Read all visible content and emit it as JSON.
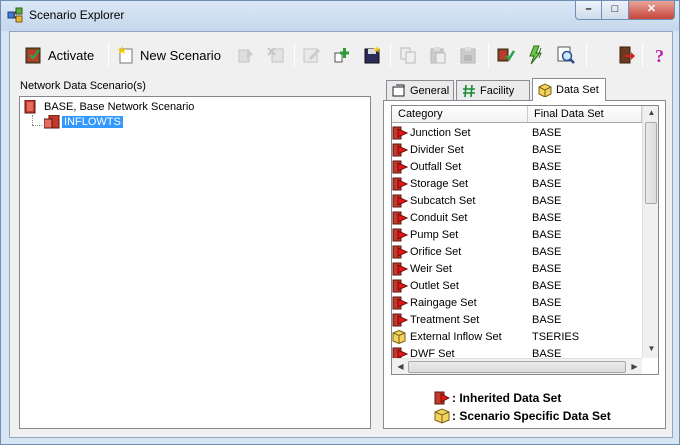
{
  "window": {
    "title": "Scenario Explorer"
  },
  "toolbar": {
    "activate_label": "Activate",
    "new_scenario_label": "New Scenario"
  },
  "left_pane": {
    "header": "Network Data Scenario(s)",
    "tree": [
      {
        "label": "BASE, Base Network Scenario",
        "level": 0,
        "selected": false
      },
      {
        "label": "INFLOWTS",
        "level": 1,
        "selected": true
      }
    ]
  },
  "tabs": [
    {
      "label": "General",
      "icon": "general-icon",
      "active": false
    },
    {
      "label": "Facility",
      "icon": "hash-icon",
      "active": false
    },
    {
      "label": "Data Set",
      "icon": "box-icon",
      "active": true
    }
  ],
  "data_set_grid": {
    "columns": [
      "Category",
      "Final Data Set"
    ],
    "rows": [
      {
        "category": "Junction Set",
        "value": "BASE",
        "type": "inherited"
      },
      {
        "category": "Divider Set",
        "value": "BASE",
        "type": "inherited"
      },
      {
        "category": "Outfall Set",
        "value": "BASE",
        "type": "inherited"
      },
      {
        "category": "Storage Set",
        "value": "BASE",
        "type": "inherited"
      },
      {
        "category": "Subcatch Set",
        "value": "BASE",
        "type": "inherited"
      },
      {
        "category": "Conduit Set",
        "value": "BASE",
        "type": "inherited"
      },
      {
        "category": "Pump Set",
        "value": "BASE",
        "type": "inherited"
      },
      {
        "category": "Orifice Set",
        "value": "BASE",
        "type": "inherited"
      },
      {
        "category": "Weir Set",
        "value": "BASE",
        "type": "inherited"
      },
      {
        "category": "Outlet Set",
        "value": "BASE",
        "type": "inherited"
      },
      {
        "category": "Raingage Set",
        "value": "BASE",
        "type": "inherited"
      },
      {
        "category": "Treatment Set",
        "value": "BASE",
        "type": "inherited"
      },
      {
        "category": "External Inflow Set",
        "value": "TSERIES",
        "type": "specific"
      },
      {
        "category": "DWF Set",
        "value": "BASE",
        "type": "inherited"
      }
    ]
  },
  "legend": {
    "inherited": ": Inherited Data Set",
    "specific": ": Scenario Specific Data Set"
  }
}
